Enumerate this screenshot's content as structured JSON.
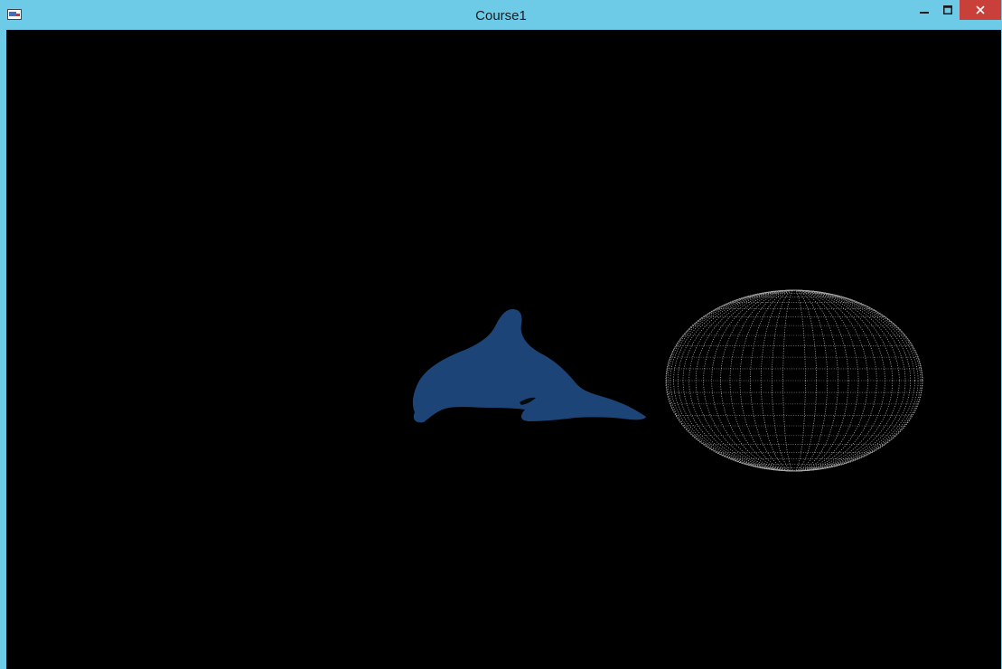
{
  "window": {
    "title": "Course1",
    "app_icon": "opengl-app-icon",
    "controls": {
      "minimize_icon": "minimize-icon",
      "maximize_icon": "maximize-icon",
      "close_icon": "close-icon"
    }
  },
  "colors": {
    "titlebar": "#6ecbe8",
    "close_button": "#c9403a",
    "viewport_background": "#000000",
    "dolphin": "#1d4476",
    "sphere_wireframe": "#c8c8c8"
  },
  "scene": {
    "objects": [
      {
        "name": "dolphin-model",
        "render": "solid",
        "color": "#1d4476"
      },
      {
        "name": "sphere-point-cloud",
        "render": "points",
        "color": "#c8c8c8"
      }
    ]
  }
}
